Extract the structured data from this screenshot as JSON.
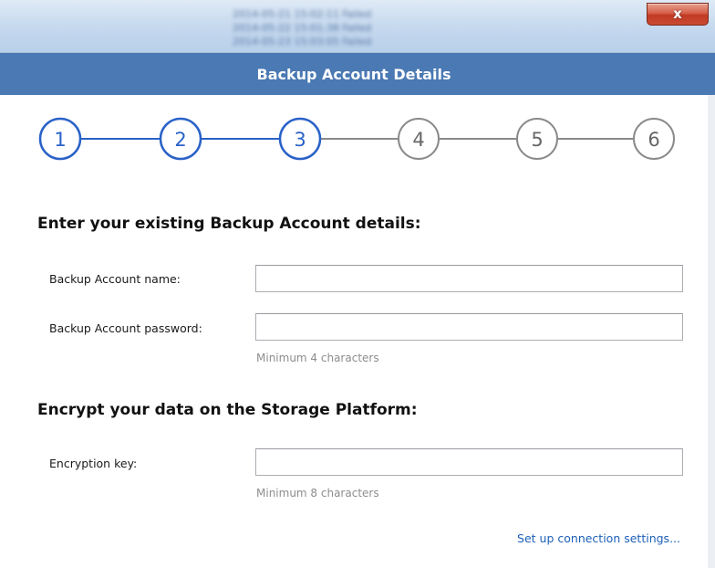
{
  "window": {
    "blurred_background_lines": [
      "2014-05-21  15:02:11  Failed",
      "2014-05-22  15:01:38  Failed",
      "2014-05-23  15:03:05  Failed"
    ],
    "close_glyph": "x",
    "close_button_color": "#c94a31"
  },
  "header": {
    "title": "Backup Account Details",
    "background_color": "#4a79b3"
  },
  "stepper": {
    "steps": [
      "1",
      "2",
      "3",
      "4",
      "5",
      "6"
    ],
    "active_through": 3,
    "active_color": "#2a62c8",
    "inactive_color": "#8a8a8a"
  },
  "account_section": {
    "title": "Enter your existing Backup Account details:",
    "name_label": "Backup Account name:",
    "name_value": "",
    "password_label": "Backup Account password:",
    "password_value": "",
    "password_hint": "Minimum 4 characters"
  },
  "encryption_section": {
    "title": "Encrypt your data on the Storage Platform:",
    "key_label": "Encryption key:",
    "key_value": "",
    "key_hint": "Minimum 8 characters"
  },
  "connection_link": "Set up connection settings..."
}
